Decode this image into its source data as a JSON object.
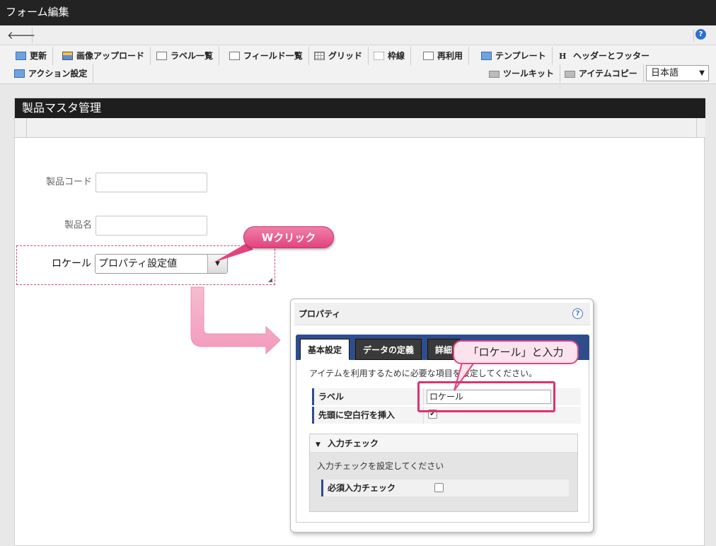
{
  "window": {
    "title": "フォーム編集"
  },
  "nav": {
    "back_icon": "arrow-left-icon",
    "help_label": "?"
  },
  "toolbar": {
    "update": "更新",
    "image_upload": "画像アップロード",
    "label_list": "ラベル一覧",
    "field_list": "フィールド一覧",
    "grid": "グリッド",
    "border": "枠線",
    "reuse": "再利用",
    "template": "テンプレート",
    "header_footer": "ヘッダーとフッター",
    "action_settings": "アクション設定",
    "toolkit": "ツールキット",
    "item_copy": "アイテムコピー",
    "language": "日本語"
  },
  "form": {
    "title": "製品マスタ管理",
    "fields": {
      "product_code": "製品コード",
      "product_name": "製品名",
      "locale": "ロケール",
      "locale_value": "プロパティ設定値"
    }
  },
  "annotations": {
    "double_click": "Wクリック",
    "enter_locale": "「ロケール」と入力"
  },
  "properties": {
    "title": "プロパティ",
    "help": "?",
    "tabs": [
      "基本設定",
      "データの定義",
      "詳細"
    ],
    "description": "アイテムを利用するために必要な項目を設定してください。",
    "label_row": "ラベル",
    "label_value": "ロケール",
    "blank_row": "先頭に空白行を挿入",
    "blank_checked": "✔",
    "input_check": {
      "title": "入力チェック",
      "description": "入力チェックを設定してください",
      "required_label": "必須入力チェック"
    }
  },
  "colors": {
    "accent_pink": "#e2447c",
    "tab_blue": "#2e4d8c"
  }
}
